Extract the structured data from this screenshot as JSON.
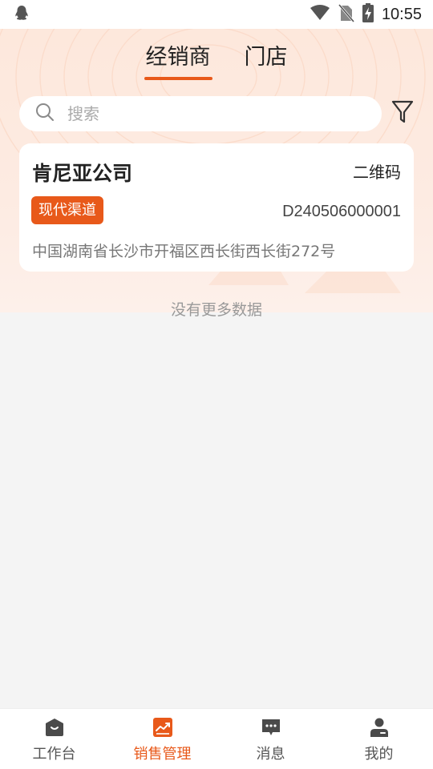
{
  "status_bar": {
    "time": "10:55",
    "icons": [
      "qq-icon",
      "wifi-icon",
      "no-sim-icon",
      "battery-charging-icon"
    ]
  },
  "tabs": [
    {
      "label": "经销商",
      "active": true
    },
    {
      "label": "门店",
      "active": false
    }
  ],
  "search": {
    "placeholder": "搜索",
    "value": ""
  },
  "dealer": {
    "name": "肯尼亚公司",
    "qr_label": "二维码",
    "tag": "现代渠道",
    "code": "D240506000001",
    "address": "中国湖南省长沙市开福区西长街西长街272号"
  },
  "list_footer": "没有更多数据",
  "bottom_nav": [
    {
      "label": "工作台",
      "icon": "workbench-icon",
      "active": false
    },
    {
      "label": "销售管理",
      "icon": "sales-chart-icon",
      "active": true
    },
    {
      "label": "消息",
      "icon": "message-icon",
      "active": false
    },
    {
      "label": "我的",
      "icon": "profile-icon",
      "active": false
    }
  ],
  "colors": {
    "accent": "#e8591a",
    "hero_bg": "#fde8dc",
    "page_bg": "#f4f4f4",
    "inactive_icon": "#4a4a4a"
  }
}
